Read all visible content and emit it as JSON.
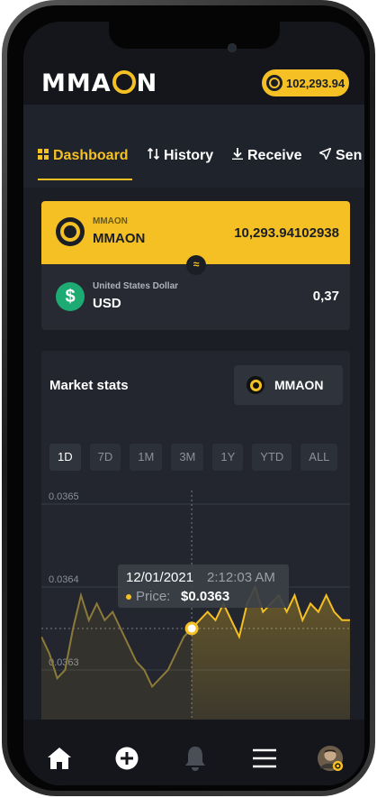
{
  "app": {
    "logo_left": "MMA",
    "logo_right": "N",
    "balance": "102,293.94"
  },
  "tabs": [
    {
      "label": "Dashboard",
      "icon": "grid-icon",
      "active": true
    },
    {
      "label": "History",
      "icon": "swap-vertical-icon"
    },
    {
      "label": "Receive",
      "icon": "download-icon"
    },
    {
      "label": "Sen",
      "icon": "send-icon"
    }
  ],
  "wallet": {
    "crypto_label": "MMAON",
    "crypto_name": "MMAON",
    "crypto_amount": "10,293.94102938",
    "swap_symbol": "≈",
    "fiat_symbol": "$",
    "fiat_label": "United States Dollar",
    "fiat_name": "USD",
    "fiat_amount": "0,37"
  },
  "market": {
    "title": "Market stats",
    "coin_button": "MMAON",
    "periods": [
      "1D",
      "7D",
      "1M",
      "3M",
      "1Y",
      "YTD",
      "ALL"
    ],
    "active_period": "1D",
    "tooltip": {
      "date": "12/01/2021",
      "time": "2:12:03 AM",
      "label": "Price:",
      "value": "$0.0363"
    }
  },
  "chart_data": {
    "type": "area",
    "title": "",
    "xlabel": "",
    "ylabel": "",
    "ylim": [
      0.03625,
      0.0366
    ],
    "yticks": [
      "0.0365",
      "0.0364",
      "0.0363"
    ],
    "ytick_values": [
      0.0365,
      0.0364,
      0.0363
    ],
    "series": [
      {
        "values": [
          0.03634,
          0.03632,
          0.03629,
          0.0363,
          0.03635,
          0.03639,
          0.03636,
          0.03638,
          0.03636,
          0.03637,
          0.03635,
          0.03633,
          0.03631,
          0.0363,
          0.03628,
          0.03629,
          0.0363,
          0.03632,
          0.03634,
          0.03635,
          0.03636,
          0.03637,
          0.03636,
          0.03638,
          0.03636,
          0.03634,
          0.03638,
          0.0364,
          0.03637,
          0.03638,
          0.03639,
          0.03637,
          0.03639,
          0.03636,
          0.03638,
          0.03637,
          0.03639,
          0.03637,
          0.03636,
          0.03636
        ]
      }
    ],
    "highlight_index": 19,
    "color": "#f5c023"
  },
  "nav": [
    {
      "icon": "home-icon"
    },
    {
      "icon": "add-circle-icon"
    },
    {
      "icon": "bell-icon"
    },
    {
      "icon": "menu-icon"
    },
    {
      "icon": "avatar"
    }
  ],
  "colors": {
    "accent": "#f5c023",
    "background": "#1b1e25",
    "green": "#1dab73"
  }
}
